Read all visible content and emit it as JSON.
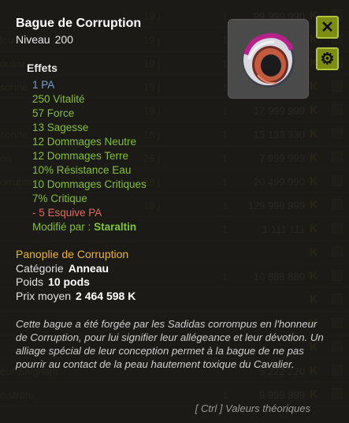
{
  "tooltip": {
    "title": "Bague de Corruption",
    "level_label": "Niveau",
    "level_value": "200",
    "effects_heading": "Effets",
    "effects": [
      {
        "text": "1 PA",
        "color": "blue"
      },
      {
        "text": "250 Vitalité",
        "color": "green"
      },
      {
        "text": "57 Force",
        "color": "green"
      },
      {
        "text": "13 Sagesse",
        "color": "green"
      },
      {
        "text": "12 Dommages Neutre",
        "color": "green"
      },
      {
        "text": "12 Dommages Terre",
        "color": "green"
      },
      {
        "text": "10% Résistance Eau",
        "color": "green"
      },
      {
        "text": "10 Dommages Critiques",
        "color": "green"
      },
      {
        "text": "7% Critique",
        "color": "green"
      },
      {
        "text": "- 5 Esquive PA",
        "color": "red"
      }
    ],
    "modified_by_label": "Modifié par :",
    "modified_by_value": "Staraltin",
    "set_name": "Panoplie de Corruption",
    "category_label": "Catégorie",
    "category_value": "Anneau",
    "weight_label": "Poids",
    "weight_value": "10 pods",
    "avg_price_label": "Prix moyen",
    "avg_price_value": "2 464 598 K",
    "description": "Cette bague a été forgée par les Sadidas corrompus en l'honneur de Corruption, pour lui signifier leur allégeance et leur dévotion. Un alliage spécial de leur conception permet à la bague de ne pas pourrir au contact de la peau hautement toxique du Cavalier.",
    "footer_hint": "[ Ctrl ] Valeurs théoriques",
    "close_icon": "close-icon",
    "settings_icon": "gear-icon",
    "colors": {
      "effect_green": "#83bf3d",
      "effect_blue": "#7a9dd4",
      "effect_red": "#e06b5d",
      "set_gold": "#ebb33a",
      "button_olive": "#7c8c14"
    }
  },
  "background_rows": [
    {
      "name": "",
      "duration": "19 j",
      "qty": "1",
      "price": "99 999 990",
      "currency": "K"
    },
    {
      "name": "lou",
      "duration": "19 j",
      "qty": "1",
      "price": "19 999 999",
      "currency": "K"
    },
    {
      "name": "oulou",
      "duration": "19 j",
      "qty": "1",
      "price": "99 999 999",
      "currency": "K"
    },
    {
      "name": "sonne",
      "duration": "19 j",
      "qty": "1",
      "price": "",
      "currency": "K"
    },
    {
      "name": "",
      "duration": "19 j",
      "qty": "1",
      "price": "17 999 999",
      "currency": "K"
    },
    {
      "name": "sonne",
      "duration": "18 j",
      "qty": "1",
      "price": "15 133 330",
      "currency": "K"
    },
    {
      "name": "on",
      "duration": "26 j",
      "qty": "1",
      "price": "7 999 999",
      "currency": "K"
    },
    {
      "name": "orruption",
      "duration": "18 j",
      "qty": "1",
      "price": "20 499 990",
      "currency": "K"
    },
    {
      "name": "",
      "duration": "19 j",
      "qty": "1",
      "price": "129 999 999",
      "currency": "K"
    },
    {
      "name": "",
      "duration": "",
      "qty": "1",
      "price": "1 111 111",
      "currency": "K"
    },
    {
      "name": "",
      "duration": "",
      "qty": "",
      "price": "",
      "currency": "K"
    },
    {
      "name": "",
      "duration": "",
      "qty": "1",
      "price": "10 888 880",
      "currency": "K"
    },
    {
      "name": "",
      "duration": "",
      "qty": "",
      "price": "",
      "currency": "K"
    },
    {
      "name": "",
      "duration": "",
      "qty": "",
      "price": "",
      "currency": "K"
    },
    {
      "name": "",
      "duration": "",
      "qty": "",
      "price": "",
      "currency": "K"
    },
    {
      "name": "eur Saignant",
      "duration": "",
      "qty": "",
      "price": "5 222 220",
      "currency": "K"
    },
    {
      "name": "nistrofu",
      "duration": "",
      "qty": "1",
      "price": "9 999 999",
      "currency": "K"
    }
  ]
}
